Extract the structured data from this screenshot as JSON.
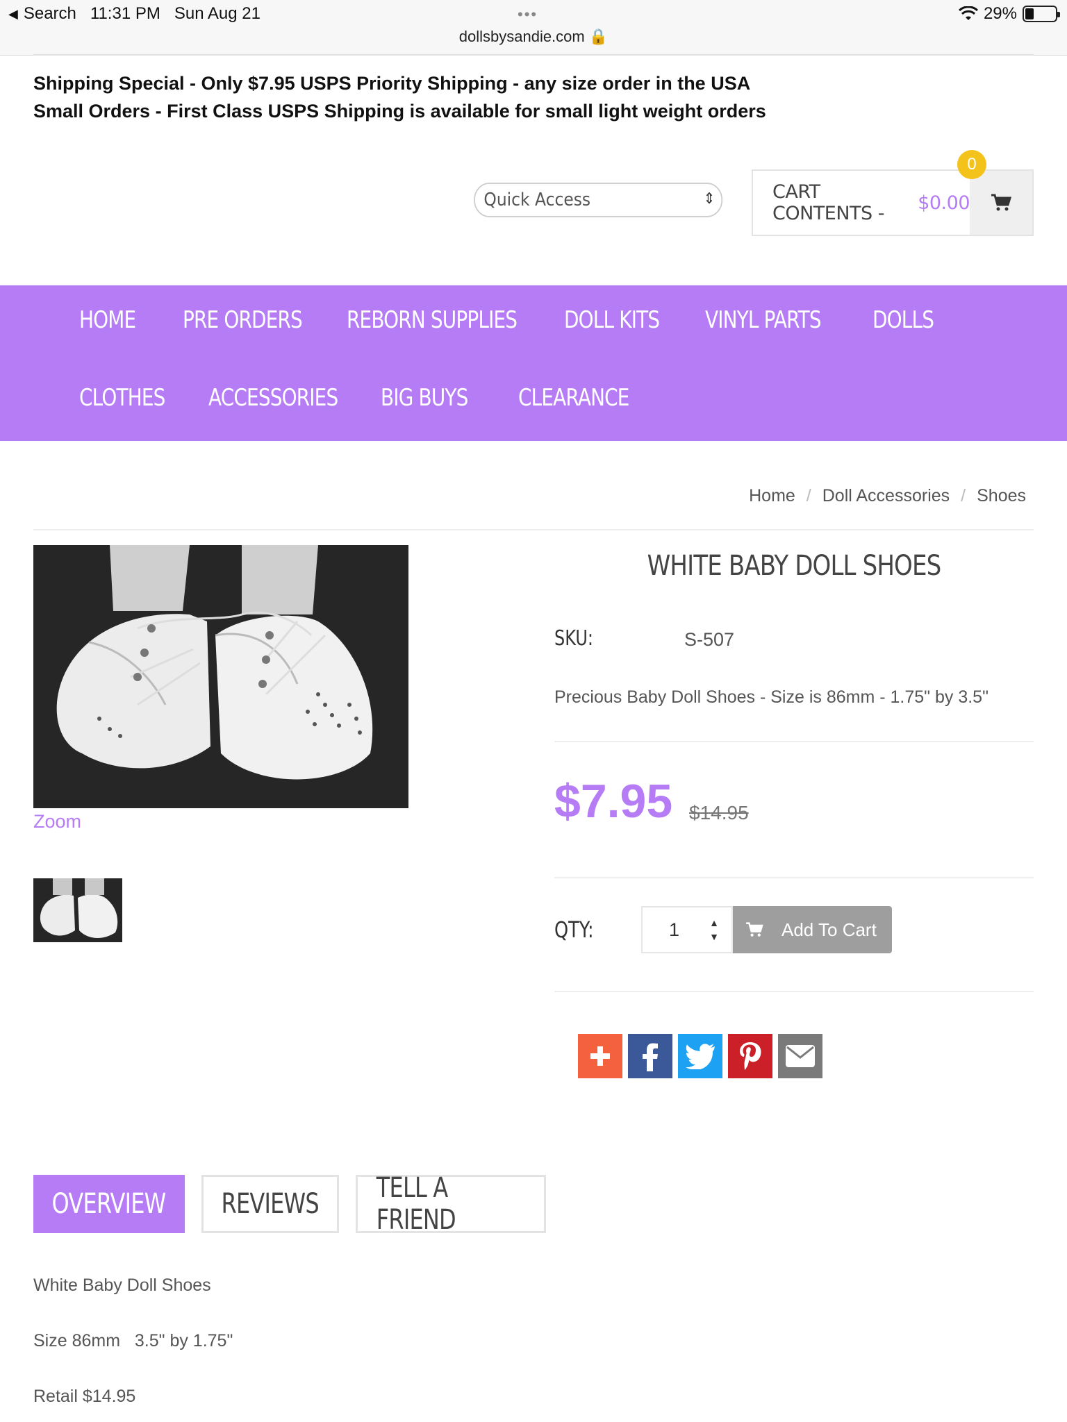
{
  "status_bar": {
    "back_label": "Search",
    "time": "11:31 PM",
    "date": "Sun Aug 21",
    "dots": "•••",
    "url": "dollsbysandie.com 🔒",
    "battery": "29%"
  },
  "shipping": {
    "line1": "Shipping Special - Only $7.95 USPS Priority Shipping - any size order in the USA",
    "line2": "Small Orders - First Class USPS Shipping is available for small light weight orders"
  },
  "header": {
    "quick_access": "Quick Access",
    "cart_label": "CART CONTENTS -",
    "cart_amount": "$0.00",
    "cart_count": "0"
  },
  "nav": {
    "items": [
      "HOME",
      "PRE ORDERS",
      "REBORN SUPPLIES",
      "DOLL KITS",
      "VINYL PARTS",
      "DOLLS",
      "CLOTHES",
      "ACCESSORIES",
      "BIG BUYS",
      "CLEARANCE"
    ]
  },
  "breadcrumb": {
    "items": [
      "Home",
      "Doll Accessories",
      "Shoes"
    ],
    "separator": "/"
  },
  "product": {
    "title": "WHITE BABY DOLL SHOES",
    "sku_label": "SKU:",
    "sku": "S-507",
    "description": "Precious Baby Doll Shoes - Size is 86mm - 1.75\" by 3.5\"",
    "price": "$7.95",
    "old_price": "$14.95",
    "zoom_label": "Zoom",
    "qty_label": "QTY:",
    "qty_value": "1",
    "add_to_cart": "Add To Cart"
  },
  "share": {
    "icons": [
      "plus-icon",
      "facebook-icon",
      "twitter-icon",
      "pinterest-icon",
      "email-icon"
    ],
    "colors": [
      "#f4613f",
      "#3b5998",
      "#1da1f2",
      "#cb2027",
      "#7a7a7a"
    ]
  },
  "tabs": {
    "overview": "OVERVIEW",
    "reviews": "REVIEWS",
    "tell_a_friend": "TELL A FRIEND"
  },
  "overview": {
    "line1": "White Baby Doll Shoes",
    "line2": "Size 86mm   3.5\" by 1.75\"",
    "line3": "Retail $14.95"
  },
  "colors": {
    "accent": "#b57cf5",
    "badge": "#f3c21b",
    "button": "#9e9e9e"
  }
}
